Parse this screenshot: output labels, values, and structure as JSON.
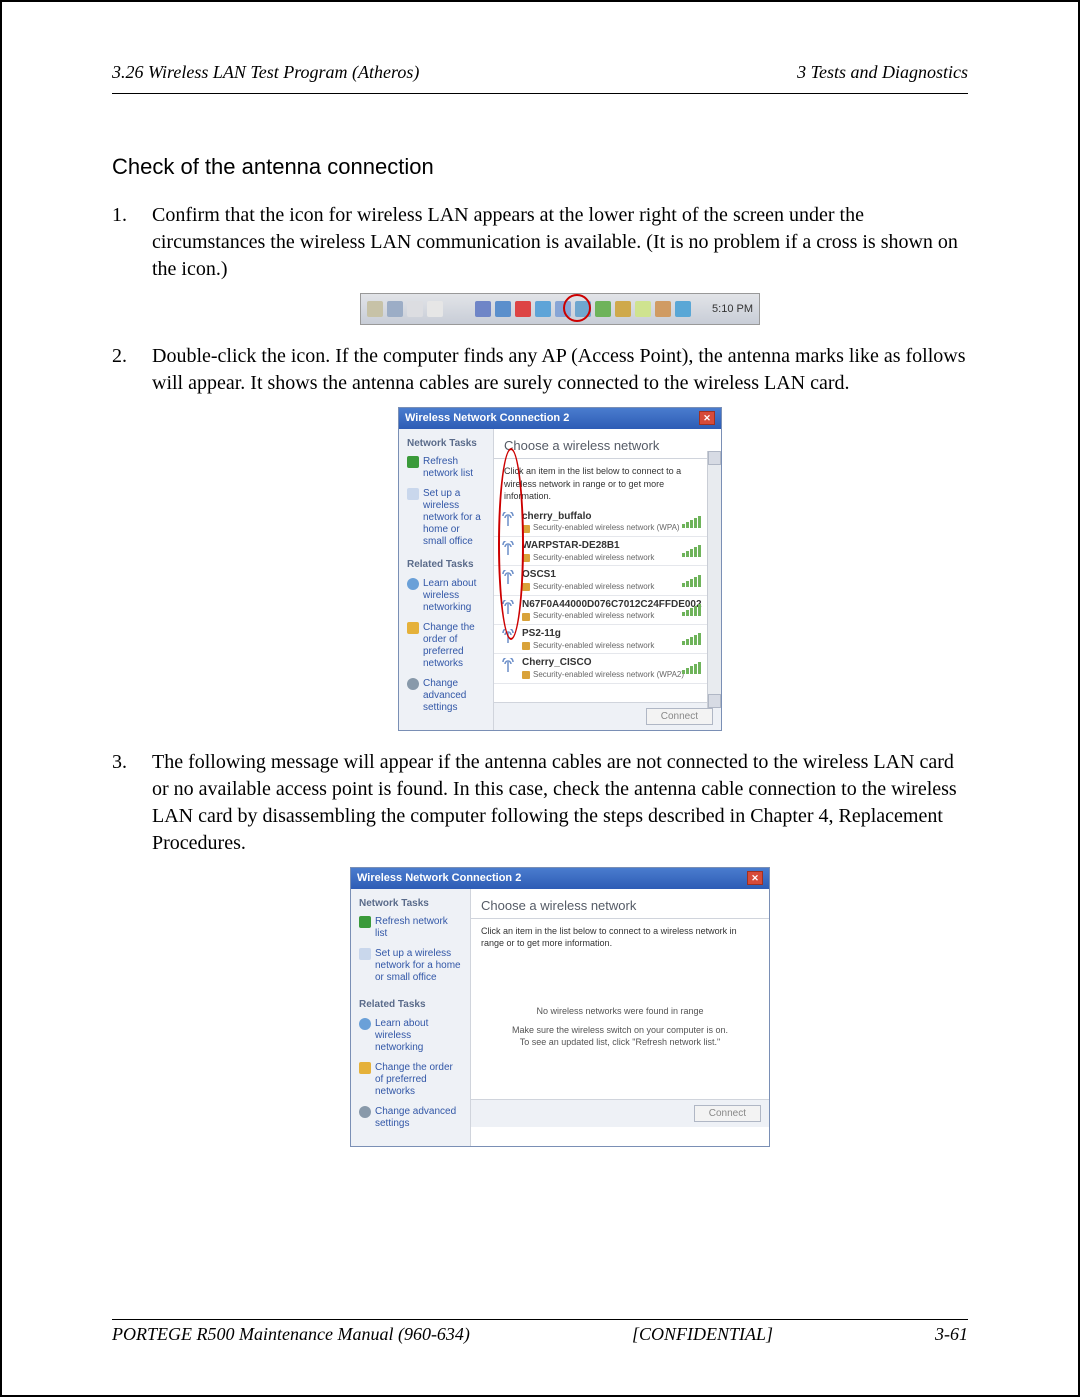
{
  "header": {
    "left": "3.26 Wireless LAN Test Program (Atheros)",
    "right": "3  Tests and Diagnostics"
  },
  "section_title": "Check of the antenna connection",
  "steps": {
    "s1": {
      "num": "1.",
      "text": "Confirm that the icon for wireless LAN appears at the lower right of the screen under the circumstances the wireless LAN communication is available. (It is no problem if a cross is shown on the icon.)"
    },
    "s2": {
      "num": "2.",
      "text": "Double-click the icon. If the computer finds any AP (Access Point), the antenna marks like as follows will appear. It shows the antenna cables are surely connected to the wireless LAN card."
    },
    "s3": {
      "num": "3.",
      "text": "The following message will appear if the antenna cables are not connected to the wireless LAN card or no available access point is found. In this case, check the antenna cable connection to the wireless LAN card by disassembling the computer following the steps described in Chapter 4, Replacement Procedures."
    }
  },
  "tray": {
    "time": "5:10 PM"
  },
  "dialog": {
    "title": "Wireless Network Connection 2",
    "sidebar": {
      "network_tasks": "Network Tasks",
      "refresh": "Refresh network list",
      "setup": "Set up a wireless network for a home or small office",
      "related_tasks": "Related Tasks",
      "learn": "Learn about wireless networking",
      "change_order": "Change the order of preferred networks",
      "change_adv": "Change advanced settings"
    },
    "main": {
      "choose": "Choose a wireless network",
      "sub": "Click an item in the list below to connect to a wireless network in range or to get more information.",
      "no_found": "No wireless networks were found in range",
      "hint1": "Make sure the wireless switch on your computer is on.",
      "hint2": "To see an updated list, click \"Refresh network list.\"",
      "connect": "Connect"
    },
    "networks": [
      {
        "name": "cherry_buffalo",
        "sec": "Security-enabled wireless network (WPA)"
      },
      {
        "name": "WARPSTAR-DE28B1",
        "sec": "Security-enabled wireless network"
      },
      {
        "name": "OSCS1",
        "sec": "Security-enabled wireless network"
      },
      {
        "name": "N67F0A44000D076C7012C24FFDE002",
        "sec": "Security-enabled wireless network"
      },
      {
        "name": "PS2-11g",
        "sec": "Security-enabled wireless network"
      },
      {
        "name": "Cherry_CISCO",
        "sec": "Security-enabled wireless network (WPA2)"
      }
    ]
  },
  "footer": {
    "left": "PORTEGE R500 Maintenance Manual (960-634)",
    "center": "[CONFIDENTIAL]",
    "right": "3-61"
  }
}
